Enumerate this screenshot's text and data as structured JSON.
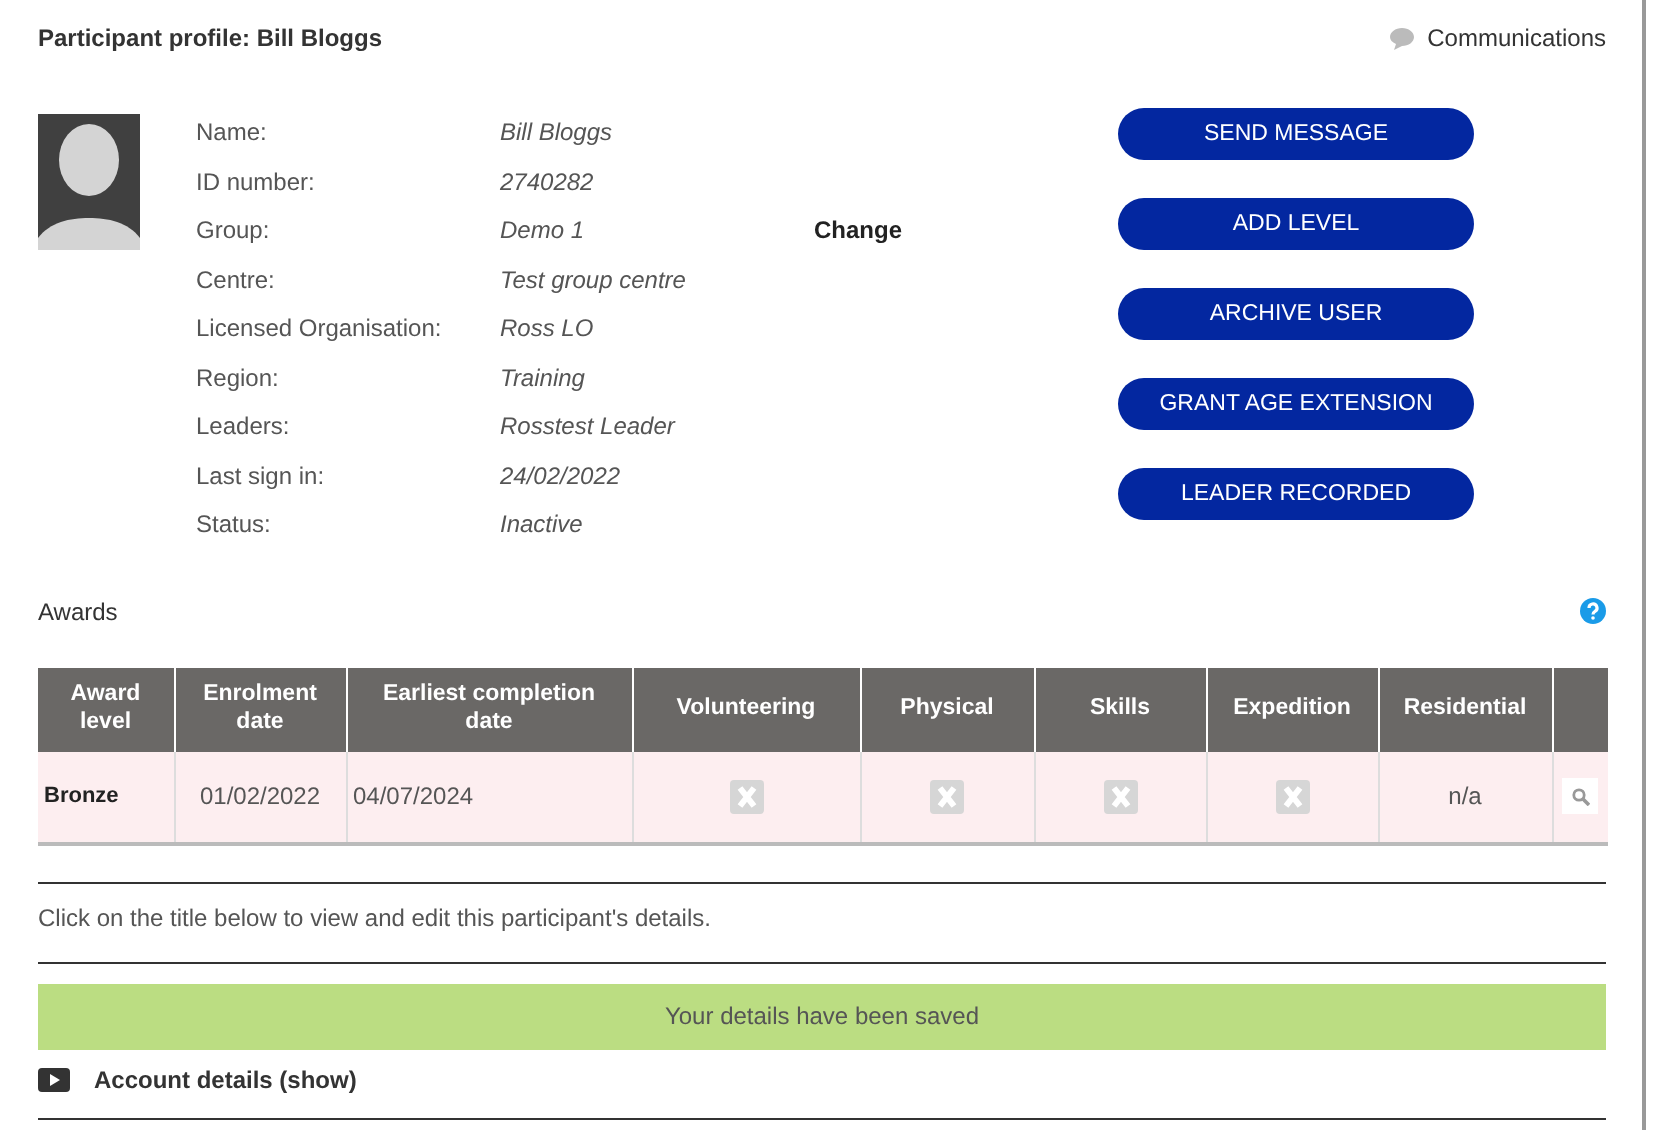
{
  "header": {
    "title": "Participant profile: Bill Bloggs",
    "communications_link": "Communications"
  },
  "details": [
    {
      "label": "Name:",
      "value": "Bill Bloggs"
    },
    {
      "label": "ID number:",
      "value": "2740282"
    },
    {
      "label": "Group:",
      "value": "Demo 1",
      "action": "Change"
    },
    {
      "label": "Centre:",
      "value": "Test group centre"
    },
    {
      "label": "Licensed Organisation:",
      "value": "Ross LO"
    },
    {
      "label": "Region:",
      "value": "Training"
    },
    {
      "label": "Leaders:",
      "value": "Rosstest Leader"
    },
    {
      "label": "Last sign in:",
      "value": "24/02/2022"
    },
    {
      "label": "Status:",
      "value": "Inactive"
    }
  ],
  "buttons": [
    "SEND MESSAGE",
    "ADD LEVEL",
    "ARCHIVE USER",
    "GRANT AGE EXTENSION",
    "LEADER RECORDED"
  ],
  "awards": {
    "title": "Awards",
    "table": {
      "columns": [
        "Award level",
        "Enrolment date",
        "Earliest completion date",
        "Volunteering",
        "Physical",
        "Skills",
        "Expedition",
        "Residential"
      ],
      "rows": [
        {
          "cells": [
            {
              "kind": "bold",
              "text": "Bronze"
            },
            {
              "kind": "text",
              "text": "01/02/2022"
            },
            {
              "kind": "left",
              "text": "04/07/2024"
            },
            {
              "kind": "cross"
            },
            {
              "kind": "cross"
            },
            {
              "kind": "cross"
            },
            {
              "kind": "cross"
            },
            {
              "kind": "text",
              "text": "n/a"
            }
          ]
        }
      ]
    }
  },
  "instructions": "Click on the title below to view and edit this participant's details.",
  "notice": "Your details have been saved",
  "sections": [
    {
      "title": "Account details (show)",
      "expanded": false
    }
  ]
}
